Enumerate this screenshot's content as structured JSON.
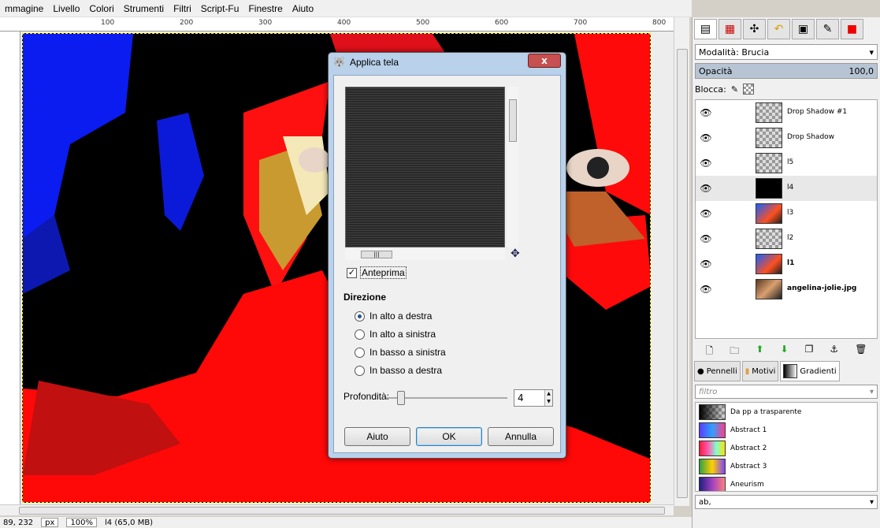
{
  "menu": [
    "mmagine",
    "Livello",
    "Colori",
    "Strumenti",
    "Filtri",
    "Script-Fu",
    "Finestre",
    "Aiuto"
  ],
  "ruler_ticks": [
    "100",
    "200",
    "300",
    "400",
    "500",
    "600",
    "700",
    "800"
  ],
  "status": {
    "coords": "89, 232",
    "zoom": "100%",
    "info": "l4 (65,0 MB)"
  },
  "dock": {
    "mode_label": "Modalità: Brucia",
    "opacity_label": "Opacità",
    "opacity_value": "100,0",
    "lock_label": "Blocca:",
    "layers": [
      {
        "name": "Drop Shadow #1",
        "bold": false
      },
      {
        "name": "Drop Shadow",
        "bold": false
      },
      {
        "name": "l5",
        "bold": false
      },
      {
        "name": "l4",
        "bold": false
      },
      {
        "name": "l3",
        "bold": false
      },
      {
        "name": "l2",
        "bold": false
      },
      {
        "name": "l1",
        "bold": true
      },
      {
        "name": "angelina-jolie.jpg",
        "bold": true
      }
    ],
    "tabs2": [
      "Pennelli",
      "Motivi",
      "Gradienti"
    ],
    "filter_placeholder": "filtro",
    "gradients": [
      "Da pp a trasparente",
      "Abstract 1",
      "Abstract 2",
      "Abstract 3",
      "Aneurism"
    ],
    "ab_value": "ab,"
  },
  "dialog": {
    "title": "Applica tela",
    "close": "x",
    "preview_label": "Anteprima",
    "direction_title": "Direzione",
    "directions": [
      "In alto a destra",
      "In alto a sinistra",
      "In basso a sinistra",
      "In basso a destra"
    ],
    "depth_label": "Profondità:",
    "depth_value": "4",
    "buttons": {
      "help": "Aiuto",
      "ok": "OK",
      "cancel": "Annulla"
    }
  }
}
